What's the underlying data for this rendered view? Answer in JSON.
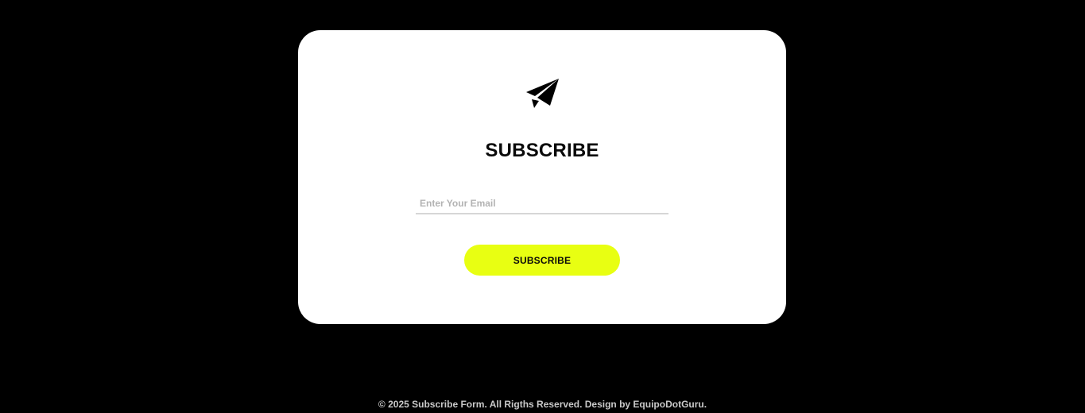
{
  "card": {
    "icon": "paper-plane-icon",
    "title": "SUBSCRIBE",
    "email_placeholder": "Enter Your Email",
    "email_value": "",
    "button_label": "SUBSCRIBE"
  },
  "footer": {
    "text": "© 2025 Subscribe Form. All Rigths Reserved. Design by EquipoDotGuru."
  },
  "colors": {
    "background": "#000000",
    "card": "#ffffff",
    "accent": "#e8ff12",
    "footer_text": "#c9c9c9"
  }
}
